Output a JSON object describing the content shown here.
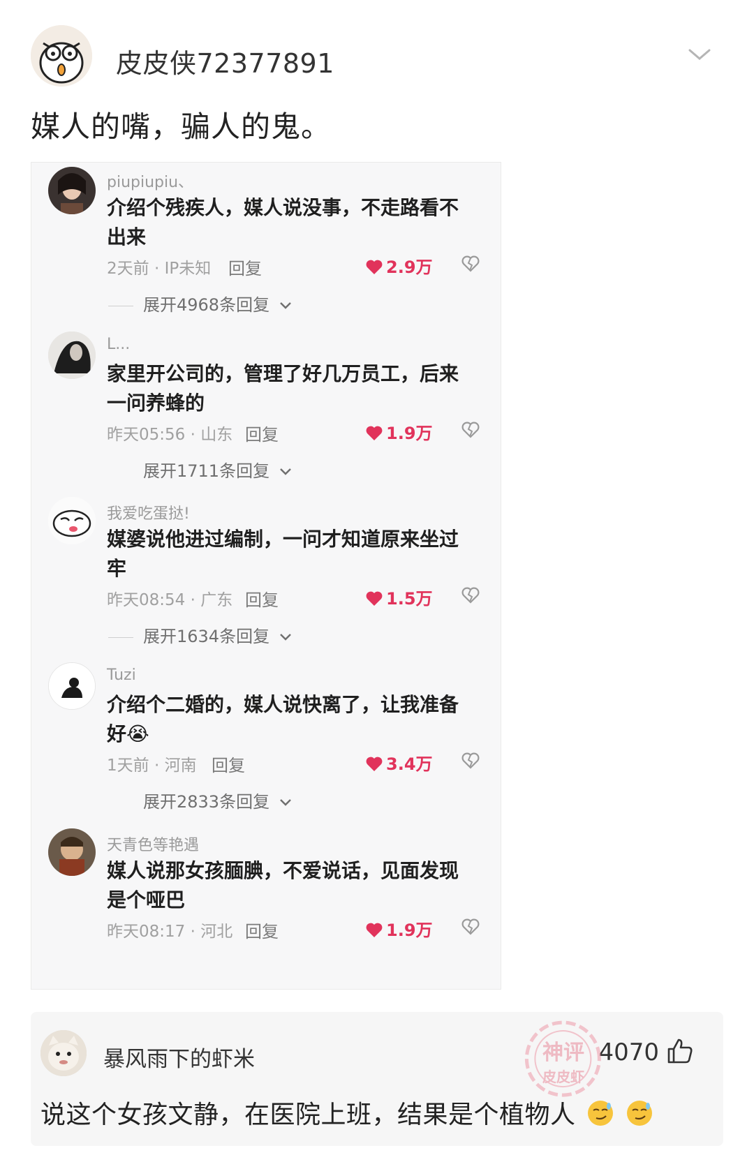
{
  "post": {
    "username": "皮皮侠72377891",
    "text": "媒人的嘴，骗人的鬼。"
  },
  "embedded_comments": [
    {
      "user": "piupiupiu、",
      "text_line1": "介绍个残疾人，媒人说没事，不走路看不",
      "text_line2": "出来",
      "meta": "2天前 · IP未知",
      "reply": "回复",
      "likes": "2.9万",
      "expand": "展开4968条回复"
    },
    {
      "user": "L...",
      "text_line1": "家里开公司的，管理了好几万员工，后来",
      "text_line2": "一问养蜂的",
      "meta": "昨天05:56 · 山东",
      "reply": "回复",
      "likes": "1.9万",
      "expand": "展开1711条回复"
    },
    {
      "user": "我爱吃蛋挞!",
      "text_line1": "媒婆说他进过编制，一问才知道原来坐过",
      "text_line2": "牢",
      "meta": "昨天08:54 · 广东",
      "reply": "回复",
      "likes": "1.5万",
      "expand": "展开1634条回复"
    },
    {
      "user": "Tuzi",
      "text_line1": "介绍个二婚的，媒人说快离了，让我准备",
      "text_line2": "好😭",
      "meta": "1天前 · 河南",
      "reply": "回复",
      "likes": "3.4万",
      "expand": "展开2833条回复"
    },
    {
      "user": "天青色等艳遇",
      "text_line1": "媒人说那女孩腼腆，不爱说话，见面发现",
      "text_line2": "是个哑巴",
      "meta": "昨天08:17 · 河北",
      "reply": "回复",
      "likes": "1.9万"
    }
  ],
  "top_comment": {
    "user": "暴风雨下的虾米",
    "likes": "4070",
    "text": "说这个女孩文静，在医院上班，结果是个植物人"
  },
  "watermark": {
    "line1": "神评",
    "line2": "皮皮虾"
  },
  "colors": {
    "like_red": "#e1335b",
    "muted": "#a0a0a0"
  }
}
